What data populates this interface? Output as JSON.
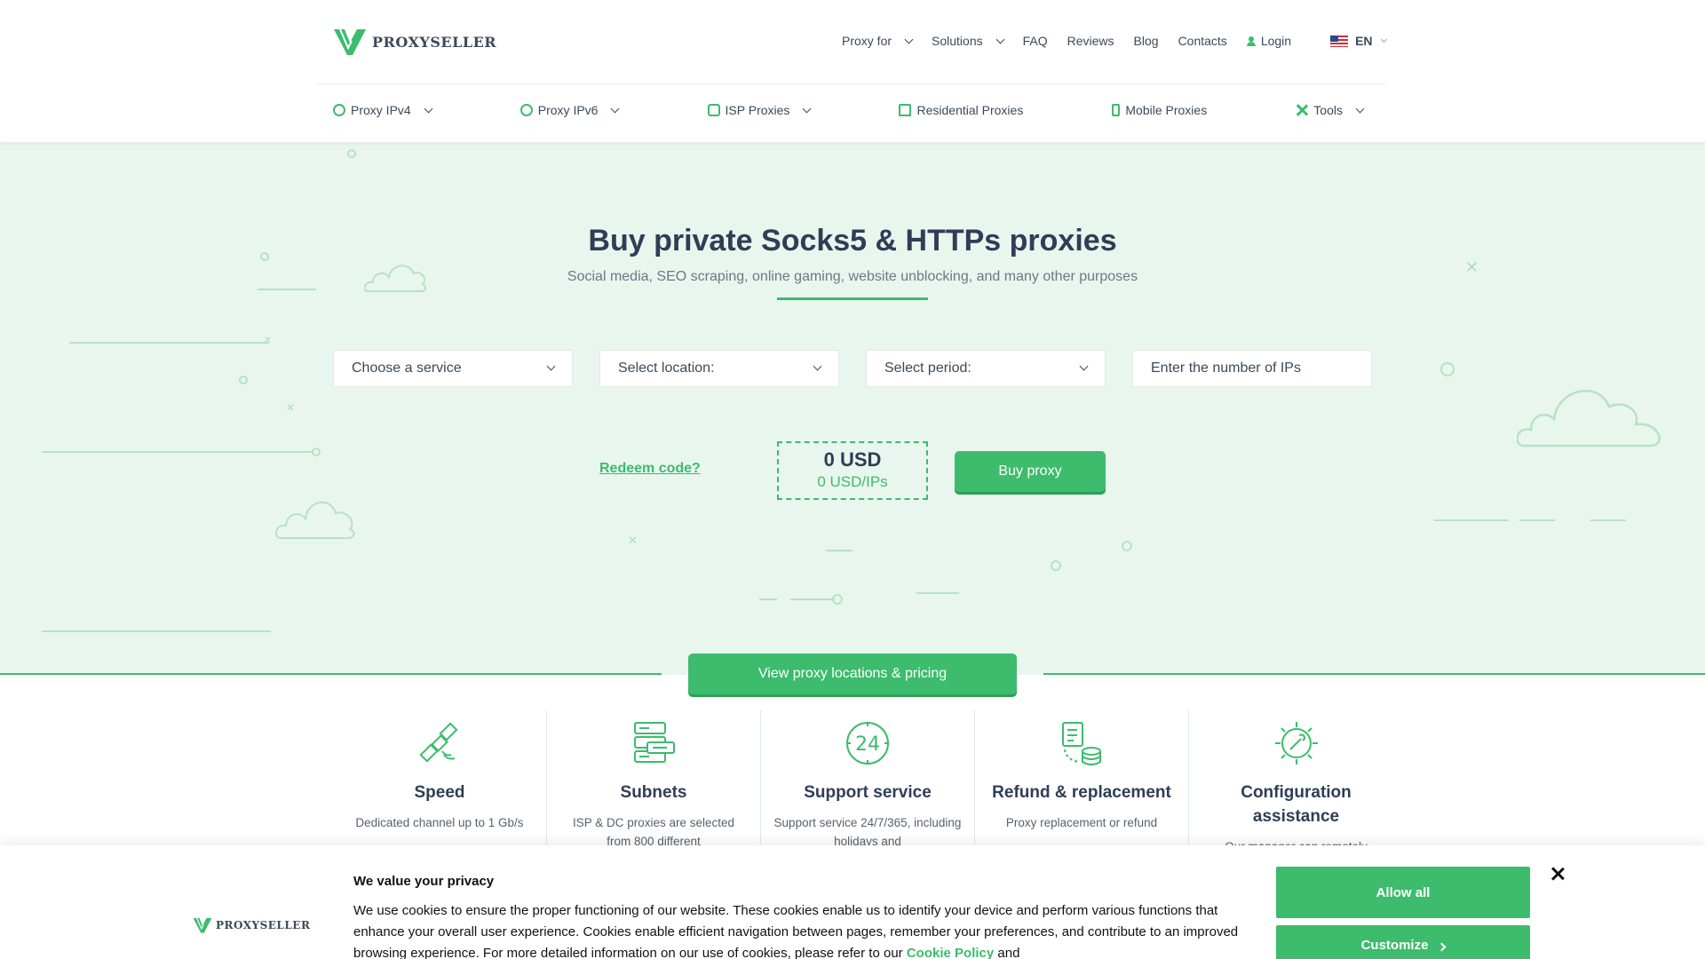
{
  "brand": {
    "name": "PROXYSELLER",
    "accent": "#3cbc6c",
    "hero_bg": "#e9f6ee"
  },
  "topnav": {
    "proxy_for": "Proxy for",
    "solutions": "Solutions",
    "faq": "FAQ",
    "reviews": "Reviews",
    "blog": "Blog",
    "contacts": "Contacts",
    "login": "Login",
    "lang": "EN"
  },
  "subnav": {
    "ipv4": "Proxy IPv4",
    "ipv6": "Proxy IPv6",
    "isp": "ISP Proxies",
    "residential": "Residential Proxies",
    "mobile": "Mobile Proxies",
    "tools": "Tools"
  },
  "hero": {
    "title": "Buy private Socks5 & HTTPs proxies",
    "subtitle": "Social media, SEO scraping, online gaming, website unblocking, and many other purposes",
    "service_select": "Choose a service",
    "location_select": "Select location:",
    "period_select": "Select period:",
    "ips_placeholder": "Enter the number of IPs",
    "redeem": "Redeem code?",
    "price_total": "0 USD",
    "price_per_ip": "0 USD/IPs",
    "buy_button": "Buy proxy",
    "locations_button": "View proxy locations & pricing"
  },
  "features": [
    {
      "title": "Speed",
      "desc": "Dedicated channel up to 1 Gb/s",
      "icon": "satellite-icon"
    },
    {
      "title": "Subnets",
      "desc": "ISP & DC proxies are selected from 800 different",
      "icon": "server-stack-icon"
    },
    {
      "title": "Support service",
      "desc": "Support service 24/7/365, including holidays and",
      "icon": "support-24-icon"
    },
    {
      "title": "Refund & replacement",
      "desc": "Proxy replacement or refund",
      "icon": "refund-database-icon"
    },
    {
      "title": "Configuration assistance",
      "desc": "Our manager can remotely",
      "icon": "gear-wrench-icon"
    }
  ],
  "cookie": {
    "title": "We value your privacy",
    "text": "We use cookies to ensure the proper functioning of our website. These cookies enable us to identify your device and perform various functions that enhance your overall user experience. Cookies enable efficient navigation between pages, remember your preferences, and contribute to an improved browsing experience. For more detailed information on our use of cookies, please refer to our",
    "policy_link": "Cookie Policy",
    "text_after": "and",
    "allow_all": "Allow all",
    "customize": "Customize"
  }
}
